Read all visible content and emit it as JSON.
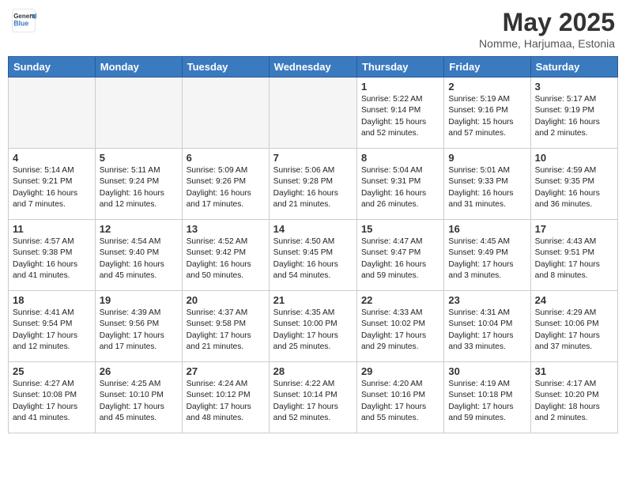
{
  "header": {
    "logo_line1": "General",
    "logo_line2": "Blue",
    "title": "May 2025",
    "subtitle": "Nomme, Harjumaa, Estonia"
  },
  "weekdays": [
    "Sunday",
    "Monday",
    "Tuesday",
    "Wednesday",
    "Thursday",
    "Friday",
    "Saturday"
  ],
  "weeks": [
    [
      {
        "day": "",
        "info": ""
      },
      {
        "day": "",
        "info": ""
      },
      {
        "day": "",
        "info": ""
      },
      {
        "day": "",
        "info": ""
      },
      {
        "day": "1",
        "info": "Sunrise: 5:22 AM\nSunset: 9:14 PM\nDaylight: 15 hours\nand 52 minutes."
      },
      {
        "day": "2",
        "info": "Sunrise: 5:19 AM\nSunset: 9:16 PM\nDaylight: 15 hours\nand 57 minutes."
      },
      {
        "day": "3",
        "info": "Sunrise: 5:17 AM\nSunset: 9:19 PM\nDaylight: 16 hours\nand 2 minutes."
      }
    ],
    [
      {
        "day": "4",
        "info": "Sunrise: 5:14 AM\nSunset: 9:21 PM\nDaylight: 16 hours\nand 7 minutes."
      },
      {
        "day": "5",
        "info": "Sunrise: 5:11 AM\nSunset: 9:24 PM\nDaylight: 16 hours\nand 12 minutes."
      },
      {
        "day": "6",
        "info": "Sunrise: 5:09 AM\nSunset: 9:26 PM\nDaylight: 16 hours\nand 17 minutes."
      },
      {
        "day": "7",
        "info": "Sunrise: 5:06 AM\nSunset: 9:28 PM\nDaylight: 16 hours\nand 21 minutes."
      },
      {
        "day": "8",
        "info": "Sunrise: 5:04 AM\nSunset: 9:31 PM\nDaylight: 16 hours\nand 26 minutes."
      },
      {
        "day": "9",
        "info": "Sunrise: 5:01 AM\nSunset: 9:33 PM\nDaylight: 16 hours\nand 31 minutes."
      },
      {
        "day": "10",
        "info": "Sunrise: 4:59 AM\nSunset: 9:35 PM\nDaylight: 16 hours\nand 36 minutes."
      }
    ],
    [
      {
        "day": "11",
        "info": "Sunrise: 4:57 AM\nSunset: 9:38 PM\nDaylight: 16 hours\nand 41 minutes."
      },
      {
        "day": "12",
        "info": "Sunrise: 4:54 AM\nSunset: 9:40 PM\nDaylight: 16 hours\nand 45 minutes."
      },
      {
        "day": "13",
        "info": "Sunrise: 4:52 AM\nSunset: 9:42 PM\nDaylight: 16 hours\nand 50 minutes."
      },
      {
        "day": "14",
        "info": "Sunrise: 4:50 AM\nSunset: 9:45 PM\nDaylight: 16 hours\nand 54 minutes."
      },
      {
        "day": "15",
        "info": "Sunrise: 4:47 AM\nSunset: 9:47 PM\nDaylight: 16 hours\nand 59 minutes."
      },
      {
        "day": "16",
        "info": "Sunrise: 4:45 AM\nSunset: 9:49 PM\nDaylight: 17 hours\nand 3 minutes."
      },
      {
        "day": "17",
        "info": "Sunrise: 4:43 AM\nSunset: 9:51 PM\nDaylight: 17 hours\nand 8 minutes."
      }
    ],
    [
      {
        "day": "18",
        "info": "Sunrise: 4:41 AM\nSunset: 9:54 PM\nDaylight: 17 hours\nand 12 minutes."
      },
      {
        "day": "19",
        "info": "Sunrise: 4:39 AM\nSunset: 9:56 PM\nDaylight: 17 hours\nand 17 minutes."
      },
      {
        "day": "20",
        "info": "Sunrise: 4:37 AM\nSunset: 9:58 PM\nDaylight: 17 hours\nand 21 minutes."
      },
      {
        "day": "21",
        "info": "Sunrise: 4:35 AM\nSunset: 10:00 PM\nDaylight: 17 hours\nand 25 minutes."
      },
      {
        "day": "22",
        "info": "Sunrise: 4:33 AM\nSunset: 10:02 PM\nDaylight: 17 hours\nand 29 minutes."
      },
      {
        "day": "23",
        "info": "Sunrise: 4:31 AM\nSunset: 10:04 PM\nDaylight: 17 hours\nand 33 minutes."
      },
      {
        "day": "24",
        "info": "Sunrise: 4:29 AM\nSunset: 10:06 PM\nDaylight: 17 hours\nand 37 minutes."
      }
    ],
    [
      {
        "day": "25",
        "info": "Sunrise: 4:27 AM\nSunset: 10:08 PM\nDaylight: 17 hours\nand 41 minutes."
      },
      {
        "day": "26",
        "info": "Sunrise: 4:25 AM\nSunset: 10:10 PM\nDaylight: 17 hours\nand 45 minutes."
      },
      {
        "day": "27",
        "info": "Sunrise: 4:24 AM\nSunset: 10:12 PM\nDaylight: 17 hours\nand 48 minutes."
      },
      {
        "day": "28",
        "info": "Sunrise: 4:22 AM\nSunset: 10:14 PM\nDaylight: 17 hours\nand 52 minutes."
      },
      {
        "day": "29",
        "info": "Sunrise: 4:20 AM\nSunset: 10:16 PM\nDaylight: 17 hours\nand 55 minutes."
      },
      {
        "day": "30",
        "info": "Sunrise: 4:19 AM\nSunset: 10:18 PM\nDaylight: 17 hours\nand 59 minutes."
      },
      {
        "day": "31",
        "info": "Sunrise: 4:17 AM\nSunset: 10:20 PM\nDaylight: 18 hours\nand 2 minutes."
      }
    ]
  ]
}
